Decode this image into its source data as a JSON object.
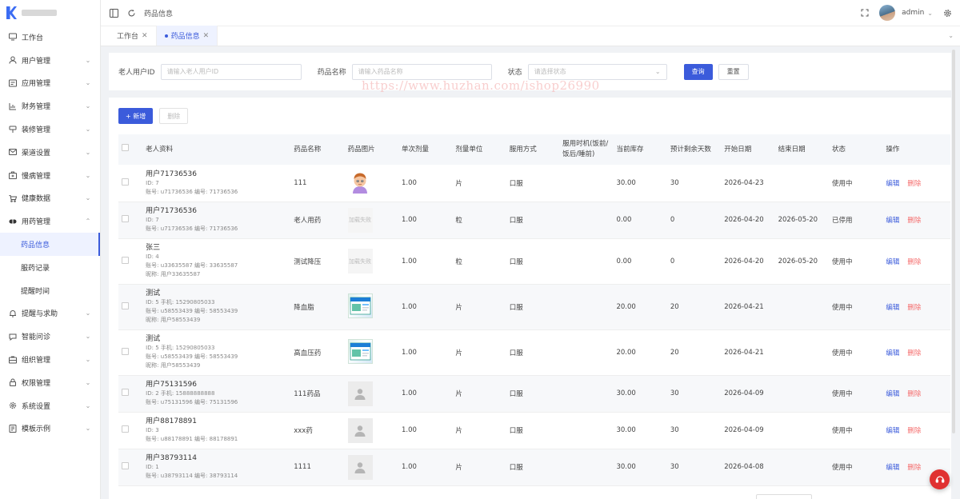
{
  "sidebar": {
    "items": [
      {
        "label": "工作台",
        "icon": "monitor-icon",
        "chev": ""
      },
      {
        "label": "用户管理",
        "icon": "user-icon",
        "chev": "⌄"
      },
      {
        "label": "应用管理",
        "icon": "app-icon",
        "chev": "⌄"
      },
      {
        "label": "财务管理",
        "icon": "chart-icon",
        "chev": "⌄"
      },
      {
        "label": "装修管理",
        "icon": "decor-icon",
        "chev": "⌄"
      },
      {
        "label": "渠道设置",
        "icon": "mail-icon",
        "chev": "⌄"
      },
      {
        "label": "慢病管理",
        "icon": "medkit-icon",
        "chev": "⌄"
      },
      {
        "label": "健康数据",
        "icon": "cart-icon",
        "chev": "⌄"
      },
      {
        "label": "用药管理",
        "icon": "pill-icon",
        "chev": "⌃"
      }
    ],
    "subitems": [
      {
        "label": "药品信息",
        "active": true
      },
      {
        "label": "服药记录",
        "active": false
      },
      {
        "label": "提醒时间",
        "active": false
      }
    ],
    "items_after": [
      {
        "label": "提醒与求助",
        "icon": "bell-icon",
        "chev": "⌄"
      },
      {
        "label": "智能问诊",
        "icon": "chat-icon",
        "chev": "⌄"
      },
      {
        "label": "组织管理",
        "icon": "org-icon",
        "chev": "⌄"
      },
      {
        "label": "权限管理",
        "icon": "lock-icon",
        "chev": "⌄"
      },
      {
        "label": "系统设置",
        "icon": "gear-icon",
        "chev": "⌄"
      },
      {
        "label": "模板示例",
        "icon": "template-icon",
        "chev": "⌄"
      }
    ]
  },
  "header": {
    "breadcrumb": "药品信息",
    "user": "admin"
  },
  "tabs": [
    {
      "label": "工作台",
      "active": false
    },
    {
      "label": "药品信息",
      "active": true
    }
  ],
  "search": {
    "elder_label": "老人用户ID",
    "elder_placeholder": "请输入老人用户ID",
    "drug_label": "药品名称",
    "drug_placeholder": "请输入药品名称",
    "status_label": "状态",
    "status_placeholder": "请选择状态",
    "query_btn": "查询",
    "reset_btn": "重置"
  },
  "watermark": "https://www.huzhan.com/ishop26990",
  "toolbar": {
    "add_btn": "+ 新增",
    "delete_btn": "删除"
  },
  "table": {
    "headers": [
      "老人资料",
      "药品名称",
      "药品图片",
      "单次剂量",
      "剂量单位",
      "服用方式",
      "服用时机(饭前/饭后/睡前)",
      "当前库存",
      "预计剩余天数",
      "开始日期",
      "结束日期",
      "状态",
      "操作"
    ],
    "edit_label": "编辑",
    "delete_label": "删除",
    "rows": [
      {
        "name": "用户71736536",
        "lines": [
          "ID: 7",
          "账号: u71736536  编号: 71736536"
        ],
        "drug": "111",
        "img": "cartoon",
        "dose": "1.00",
        "unit": "片",
        "method": "口服",
        "timing": "",
        "stock": "30.00",
        "days": "30",
        "start": "2026-04-23",
        "end": "",
        "status": "使用中"
      },
      {
        "name": "用户71736536",
        "lines": [
          "ID: 7",
          "账号: u71736536  编号: 71736536"
        ],
        "drug": "老人用药",
        "img": "fail",
        "img_text": "加载失败",
        "dose": "1.00",
        "unit": "粒",
        "method": "口服",
        "timing": "",
        "stock": "0.00",
        "days": "0",
        "start": "2026-04-20",
        "end": "2026-05-20",
        "status": "已停用"
      },
      {
        "name": "张三",
        "lines": [
          "ID: 4",
          "账号: u33635587  编号: 33635587",
          "昵称: 用户33635587"
        ],
        "drug": "测试降压",
        "img": "fail",
        "img_text": "加载失败",
        "dose": "1.00",
        "unit": "粒",
        "method": "口服",
        "timing": "",
        "stock": "0.00",
        "days": "0",
        "start": "2026-04-20",
        "end": "2026-05-20",
        "status": "使用中"
      },
      {
        "name": "测试",
        "lines": [
          "ID: 5  手机: 15290805033",
          "账号: u58553439  编号: 58553439",
          "昵称: 用户58553439"
        ],
        "drug": "降血脂",
        "img": "box",
        "dose": "1.00",
        "unit": "片",
        "method": "口服",
        "timing": "",
        "stock": "20.00",
        "days": "20",
        "start": "2026-04-21",
        "end": "",
        "status": "使用中"
      },
      {
        "name": "测试",
        "lines": [
          "ID: 5  手机: 15290805033",
          "账号: u58553439  编号: 58553439",
          "昵称: 用户58553439"
        ],
        "drug": "高血压药",
        "img": "box",
        "dose": "1.00",
        "unit": "片",
        "method": "口服",
        "timing": "",
        "stock": "20.00",
        "days": "20",
        "start": "2026-04-21",
        "end": "",
        "status": "使用中"
      },
      {
        "name": "用户75131596",
        "lines": [
          "ID: 2  手机: 15888888888",
          "账号: u75131596  编号: 75131596"
        ],
        "drug": "111药品",
        "img": "ph",
        "dose": "1.00",
        "unit": "片",
        "method": "口服",
        "timing": "",
        "stock": "30.00",
        "days": "30",
        "start": "2026-04-09",
        "end": "",
        "status": "使用中"
      },
      {
        "name": "用户88178891",
        "lines": [
          "ID: 3",
          "账号: u88178891  编号: 88178891"
        ],
        "drug": "xxx药",
        "img": "ph",
        "dose": "1.00",
        "unit": "片",
        "method": "口服",
        "timing": "",
        "stock": "30.00",
        "days": "30",
        "start": "2026-04-09",
        "end": "",
        "status": "使用中"
      },
      {
        "name": "用户38793114",
        "lines": [
          "ID: 1",
          "账号: u38793114  编号: 38793114"
        ],
        "drug": "1111",
        "img": "ph",
        "dose": "1.00",
        "unit": "片",
        "method": "口服",
        "timing": "",
        "stock": "30.00",
        "days": "30",
        "start": "2026-04-08",
        "end": "",
        "status": "使用中"
      }
    ]
  },
  "colors": {
    "primary": "#3b5bdb",
    "danger": "#f56c6c",
    "fab": "#e03131"
  }
}
